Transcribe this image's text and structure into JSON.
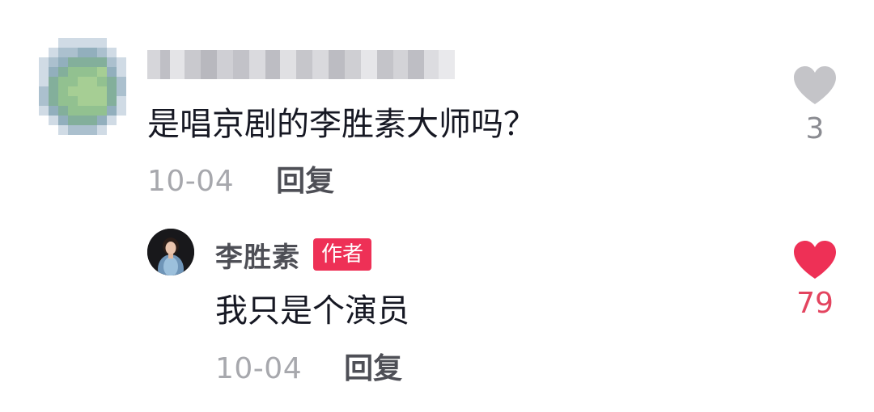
{
  "comment": {
    "text": "是唱京剧的李胜素大师吗？",
    "date": "10-04",
    "reply_label": "回复",
    "likes": "3",
    "like_icon": "heart-outline-icon",
    "like_color": "#c4c4c8"
  },
  "reply": {
    "username": "李胜素",
    "badge": "作者",
    "badge_color": "#ee3056",
    "text": "我只是个演员",
    "date": "10-04",
    "reply_label": "回复",
    "likes": "79",
    "like_icon": "heart-filled-icon",
    "like_color": "#ee3056"
  }
}
